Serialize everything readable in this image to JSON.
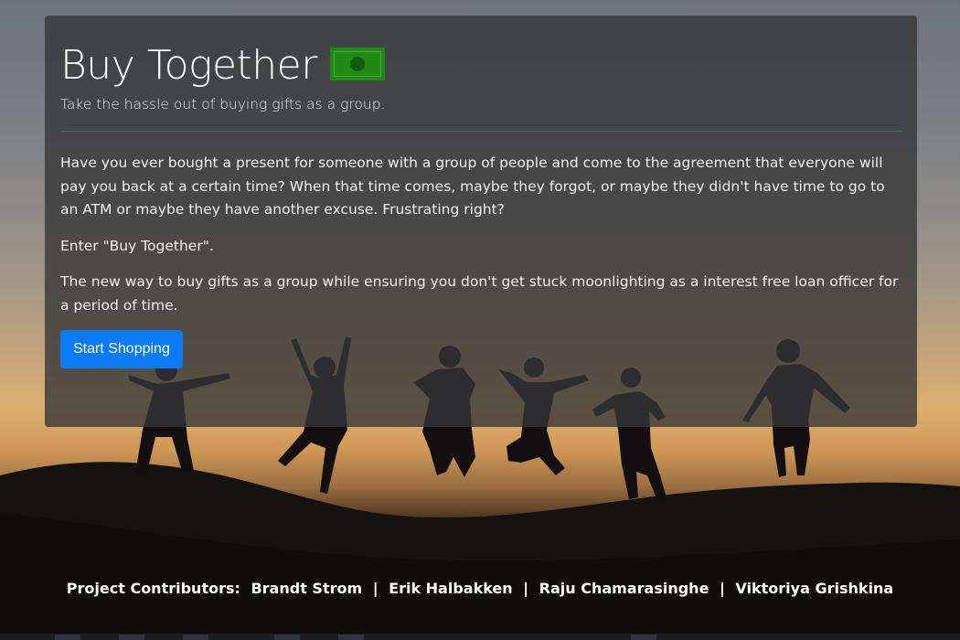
{
  "hero": {
    "title": "Buy Together",
    "subtitle": "Take the hassle out of buying gifts as a group.",
    "paragraphs": [
      "Have you ever bought a present for someone with a group of people and come to the agreement that everyone will pay you back at a certain time? When that time comes, maybe they forgot, or maybe they didn't have time to go to an ATM or maybe they have another excuse. Frustrating right?",
      "Enter \"Buy Together\".",
      "The new way to buy gifts as a group while ensuring you don't get stuck moonlighting as a interest free loan officer for a period of time."
    ],
    "cta_label": "Start Shopping",
    "icon": "money-bill-icon"
  },
  "footer": {
    "prefix": "Project Contributors:",
    "contributors": [
      "Brandt Strom",
      "Erik Halbakken",
      "Raju Chamarasinghe",
      "Viktoriya Grishkina"
    ],
    "separator": "|"
  },
  "colors": {
    "accent": "#0a7af5",
    "money_green": "#1f8a14",
    "panel": "rgba(52,52,54,0.78)"
  }
}
